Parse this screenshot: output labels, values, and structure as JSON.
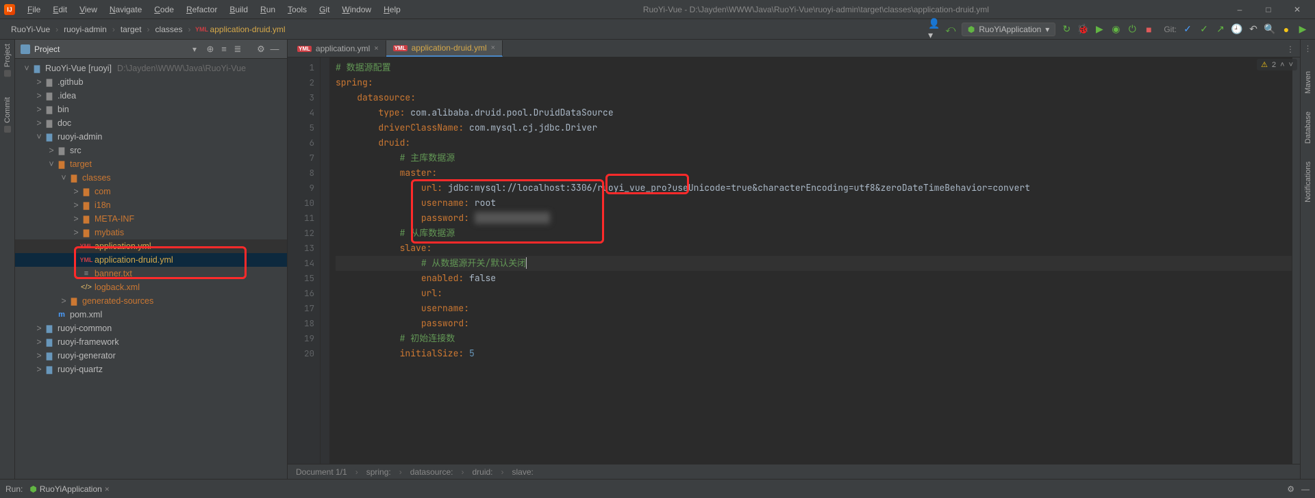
{
  "title": "RuoYi-Vue - D:\\Jayden\\WWW\\Java\\RuoYi-Vue\\ruoyi-admin\\target\\classes\\application-druid.yml",
  "menus": [
    "File",
    "Edit",
    "View",
    "Navigate",
    "Code",
    "Refactor",
    "Build",
    "Run",
    "Tools",
    "Git",
    "Window",
    "Help"
  ],
  "breadcrumbs": [
    "RuoYi-Vue",
    "ruoyi-admin",
    "target",
    "classes",
    "application-druid.yml"
  ],
  "run_config": "RuoYiApplication",
  "git_label": "Git:",
  "inspections_warn_count": "2",
  "left_stripe": [
    "Project",
    "Commit"
  ],
  "right_stripe": [
    "Maven",
    "Database",
    "Notifications"
  ],
  "project_pane_title": "Project",
  "project_root_hint": "D:\\Jayden\\WWW\\Java\\RuoYi-Vue",
  "tree": [
    {
      "d": 0,
      "tw": "˅",
      "ico": "module",
      "label": "RuoYi-Vue [ruoyi]",
      "color": "",
      "hint": "D:\\Jayden\\WWW\\Java\\RuoYi-Vue"
    },
    {
      "d": 1,
      "tw": ">",
      "ico": "folder",
      "label": ".github"
    },
    {
      "d": 1,
      "tw": ">",
      "ico": "folder",
      "label": ".idea"
    },
    {
      "d": 1,
      "tw": ">",
      "ico": "folder",
      "label": "bin"
    },
    {
      "d": 1,
      "tw": ">",
      "ico": "folder",
      "label": "doc"
    },
    {
      "d": 1,
      "tw": "˅",
      "ico": "module",
      "label": "ruoyi-admin"
    },
    {
      "d": 2,
      "tw": ">",
      "ico": "folder",
      "label": "src"
    },
    {
      "d": 2,
      "tw": "˅",
      "ico": "folder-o",
      "label": "target",
      "color": "orange"
    },
    {
      "d": 3,
      "tw": "˅",
      "ico": "folder-o",
      "label": "classes",
      "color": "orange"
    },
    {
      "d": 4,
      "tw": ">",
      "ico": "folder-o",
      "label": "com",
      "color": "orange"
    },
    {
      "d": 4,
      "tw": ">",
      "ico": "folder-o",
      "label": "i18n",
      "color": "orange"
    },
    {
      "d": 4,
      "tw": ">",
      "ico": "folder-o",
      "label": "META-INF",
      "color": "orange"
    },
    {
      "d": 4,
      "tw": ">",
      "ico": "folder-o",
      "label": "mybatis",
      "color": "orange"
    },
    {
      "d": 4,
      "tw": "",
      "ico": "yml",
      "label": "application.yml",
      "color": "sel",
      "sel": false,
      "hl": true
    },
    {
      "d": 4,
      "tw": "",
      "ico": "yml",
      "label": "application-druid.yml",
      "color": "sel",
      "sel": true
    },
    {
      "d": 4,
      "tw": "",
      "ico": "txt",
      "label": "banner.txt",
      "color": "orange"
    },
    {
      "d": 4,
      "tw": "",
      "ico": "xml",
      "label": "logback.xml",
      "color": "orange"
    },
    {
      "d": 3,
      "tw": ">",
      "ico": "folder-o",
      "label": "generated-sources",
      "color": "orange"
    },
    {
      "d": 2,
      "tw": "",
      "ico": "m",
      "label": "pom.xml"
    },
    {
      "d": 1,
      "tw": ">",
      "ico": "module",
      "label": "ruoyi-common"
    },
    {
      "d": 1,
      "tw": ">",
      "ico": "module",
      "label": "ruoyi-framework"
    },
    {
      "d": 1,
      "tw": ">",
      "ico": "module",
      "label": "ruoyi-generator"
    },
    {
      "d": 1,
      "tw": ">",
      "ico": "module",
      "label": "ruoyi-quartz"
    }
  ],
  "tabs": [
    {
      "name": "application.yml",
      "active": false
    },
    {
      "name": "application-druid.yml",
      "active": true
    }
  ],
  "code_lines": [
    {
      "n": 1,
      "html": "<span class='tok-cmt'># 数据源配置</span>"
    },
    {
      "n": 2,
      "html": "<span class='tok-key'>spring</span><span class='tok-col'>:</span>"
    },
    {
      "n": 3,
      "html": "    <span class='tok-key'>datasource</span><span class='tok-col'>:</span>"
    },
    {
      "n": 4,
      "html": "        <span class='tok-key'>type</span><span class='tok-col'>:</span> <span class='tok-val'>com.alibaba.druid.pool.DruidDataSource</span>"
    },
    {
      "n": 5,
      "html": "        <span class='tok-key'>driverClassName</span><span class='tok-col'>:</span> <span class='tok-val'>com.mysql.cj.jdbc.Driver</span>"
    },
    {
      "n": 6,
      "html": "        <span class='tok-key'>druid</span><span class='tok-col'>:</span>"
    },
    {
      "n": 7,
      "html": "            <span class='tok-cmt'># 主库数据源</span>"
    },
    {
      "n": 8,
      "html": "            <span class='tok-key'>master</span><span class='tok-col'>:</span>"
    },
    {
      "n": 9,
      "html": "                <span class='tok-key'>url</span><span class='tok-col'>:</span> <span class='tok-val'>jdbc:mysql://localhost:3306/ruoyi_vue_pro?useUnicode=true&amp;characterEncoding=utf8&amp;zeroDateTimeBehavior=convert</span>"
    },
    {
      "n": 10,
      "html": "                <span class='tok-key'>username</span><span class='tok-col'>:</span> <span class='tok-val'>root</span>"
    },
    {
      "n": 11,
      "html": "                <span class='tok-key'>password</span><span class='tok-col'>:</span> <span class='blur'>xxxxxxx</span>"
    },
    {
      "n": 12,
      "html": "            <span class='tok-cmt'># 从库数据源</span>"
    },
    {
      "n": 13,
      "html": "            <span class='tok-key'>slave</span><span class='tok-col'>:</span>"
    },
    {
      "n": 14,
      "html": "                <span class='tok-cmt'># 从数据源开关/默认关闭</span><span class='caret'></span>",
      "cur": true
    },
    {
      "n": 15,
      "html": "                <span class='tok-key'>enabled</span><span class='tok-col'>:</span> <span class='tok-val'>false</span>"
    },
    {
      "n": 16,
      "html": "                <span class='tok-key'>url</span><span class='tok-col'>:</span>"
    },
    {
      "n": 17,
      "html": "                <span class='tok-key'>username</span><span class='tok-col'>:</span>"
    },
    {
      "n": 18,
      "html": "                <span class='tok-key'>password</span><span class='tok-col'>:</span>"
    },
    {
      "n": 19,
      "html": "            <span class='tok-cmt'># 初始连接数</span>"
    },
    {
      "n": 20,
      "html": "            <span class='tok-key'>initialSize</span><span class='tok-col'>:</span> <span class='tok-num'>5</span>"
    }
  ],
  "editor_breadcrumbs": [
    "Document 1/1",
    "spring:",
    "datasource:",
    "druid:",
    "slave:"
  ],
  "bottom": {
    "label": "Run:",
    "config": "RuoYiApplication"
  }
}
